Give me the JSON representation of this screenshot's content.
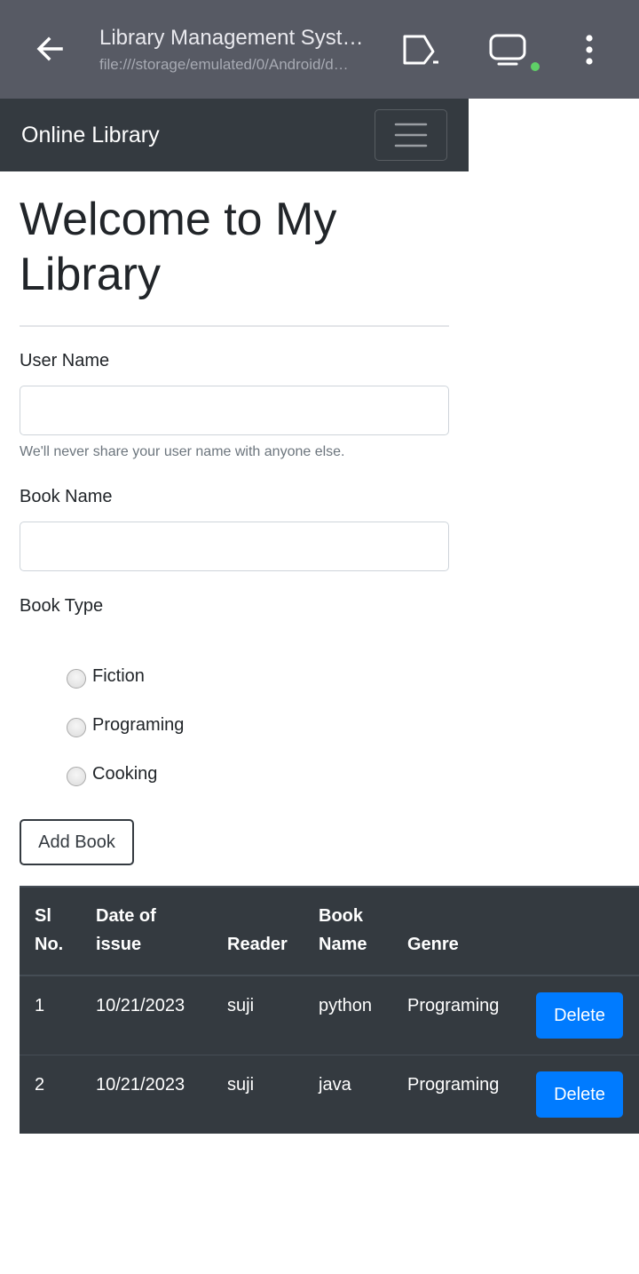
{
  "browser": {
    "title": "Library Management Syst…",
    "url": "file:///storage/emulated/0/Android/d…"
  },
  "navbar": {
    "brand": "Online Library"
  },
  "main": {
    "heading_line1": "Welcome to My",
    "heading_line2": "Library",
    "form": {
      "username_label": "User Name",
      "username_value": "",
      "username_help": "We'll never share your user name with anyone else.",
      "bookname_label": "Book Name",
      "bookname_value": "",
      "booktype_label": "Book Type",
      "options": [
        "Fiction",
        "Programing",
        "Cooking"
      ],
      "add_button": "Add Book"
    },
    "table": {
      "headers": {
        "sl_line1": "Sl",
        "sl_line2": "No.",
        "date_line1": "Date of",
        "date_line2": "issue",
        "reader": "Reader",
        "book_line1": "Book",
        "book_line2": "Name",
        "genre": "Genre"
      },
      "rows": [
        {
          "sl": "1",
          "date": "10/21/2023",
          "reader": "suji",
          "book": "python",
          "genre": "Programing",
          "action": "Delete"
        },
        {
          "sl": "2",
          "date": "10/21/2023",
          "reader": "suji",
          "book": "java",
          "genre": "Programing",
          "action": "Delete"
        }
      ]
    }
  },
  "colors": {
    "browser_bar": "#575a64",
    "navbar": "#343a40",
    "primary": "#007bff",
    "status_dot": "#5fd067"
  },
  "icons": [
    "back-arrow-icon",
    "cast-icon",
    "screen-icon",
    "more-vert-icon",
    "hamburger-icon"
  ]
}
